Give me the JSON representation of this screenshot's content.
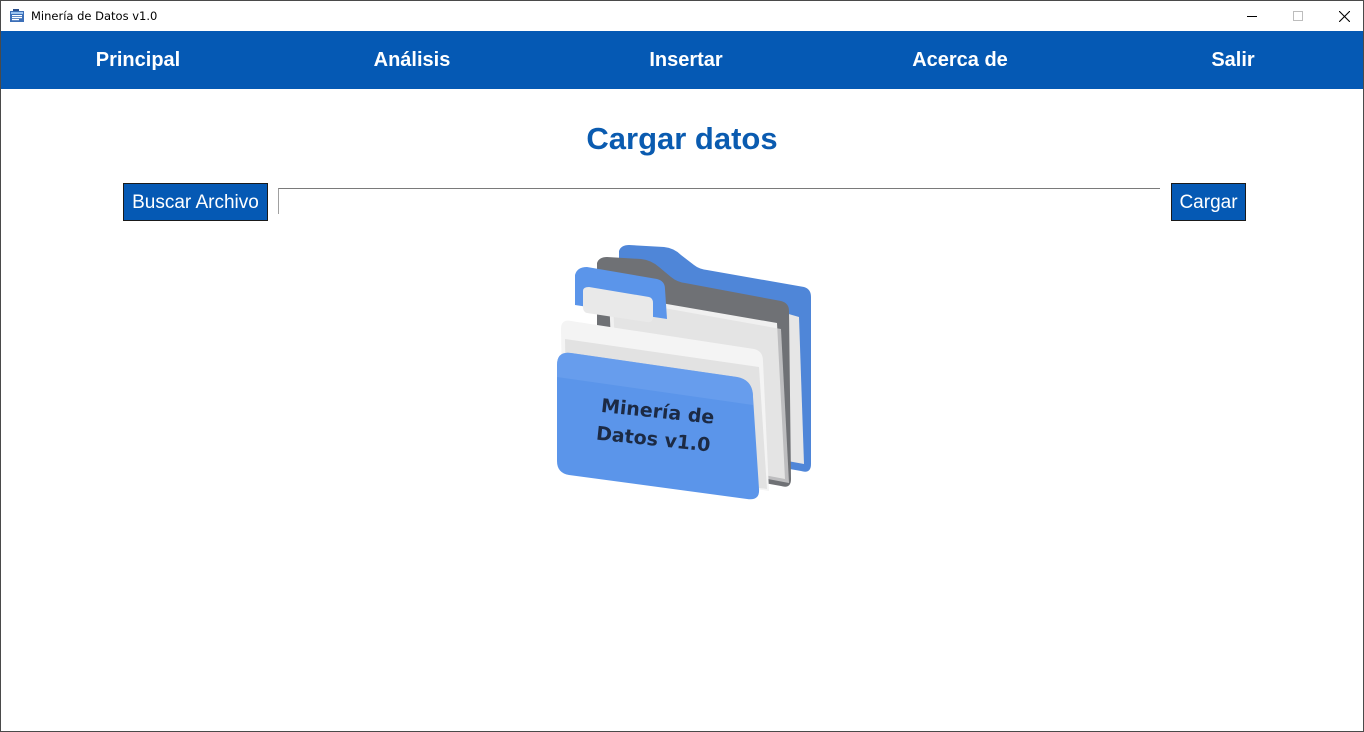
{
  "window": {
    "title": "Minería de Datos v1.0",
    "icon": "app-window-icon",
    "controls": [
      "minimize-icon",
      "maximize-icon",
      "close-icon"
    ]
  },
  "menu": {
    "items": [
      {
        "label": "Principal"
      },
      {
        "label": "Análisis"
      },
      {
        "label": "Insertar"
      },
      {
        "label": "Acerca de"
      },
      {
        "label": "Salir"
      }
    ]
  },
  "main": {
    "title": "Cargar datos",
    "browse_button": "Buscar Archivo",
    "file_path": {
      "value": "",
      "placeholder": ""
    },
    "load_button": "Cargar",
    "illustration": {
      "icon": "folder-icon",
      "label_line1": "Minería de",
      "label_line2": "Datos v1.0"
    }
  },
  "colors": {
    "accent": "#0559b4",
    "title_text": "#0a5bb0",
    "folder_blue": "#5b95ea",
    "folder_gray": "#6f7175"
  }
}
